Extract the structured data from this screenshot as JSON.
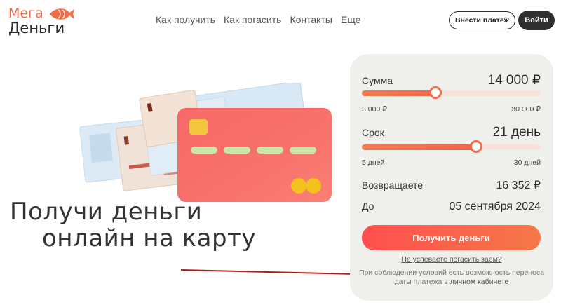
{
  "header": {
    "logo_top": "Мега",
    "logo_bottom": "Деньги",
    "nav": [
      "Как получить",
      "Как погасить",
      "Контакты",
      "Еще"
    ],
    "pay_button": "Внести платеж",
    "login_button": "Войти"
  },
  "hero": {
    "title_line1": "Получи деньги",
    "title_line2": "онлайн на карту"
  },
  "calculator": {
    "amount_label": "Сумма",
    "amount_value": "14 000 ₽",
    "amount_min": "3 000 ₽",
    "amount_max": "30 000 ₽",
    "amount_fraction": 0.41,
    "term_label": "Срок",
    "term_value": "21 день",
    "term_min": "5 дней",
    "term_max": "30 дней",
    "term_fraction": 0.64,
    "return_label": "Возвращаете",
    "return_value": "16 352 ₽",
    "due_label": "До",
    "due_value": "05 сентября 2024",
    "get_button": "Получить деньги",
    "late_link": "Не успеваете погасить заем?",
    "note_text": "При соблюдении условий есть возможность переноса даты платежа в",
    "note_link": "личном кабинете"
  },
  "colors": {
    "accent": "#f26b49",
    "card": "#efefeb",
    "dark": "#2f2f2f",
    "arrow": "#b01c1c"
  }
}
